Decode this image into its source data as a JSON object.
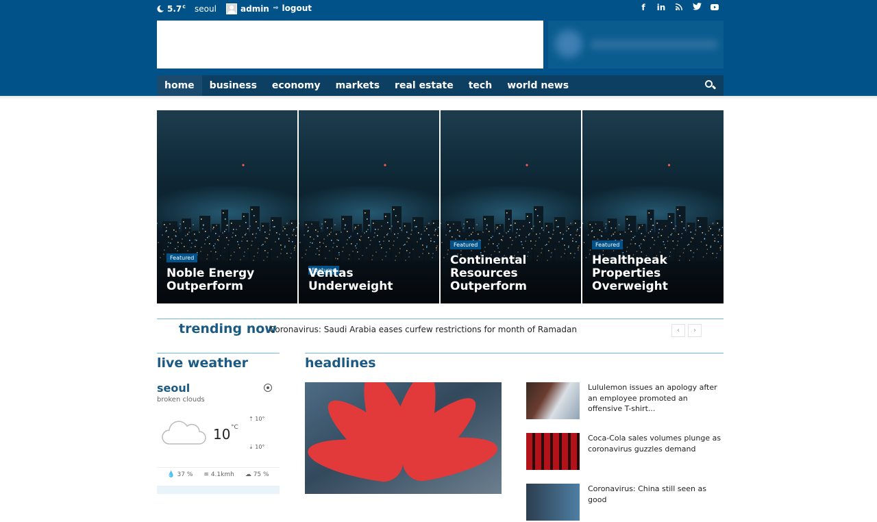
{
  "topbar": {
    "temperature": "5.7",
    "temp_unit": "c",
    "city": "seoul",
    "user": "admin",
    "logout": "logout",
    "social_glyphs": [
      "f",
      "in",
      "rss",
      "tw",
      "yt"
    ]
  },
  "nav": {
    "items": [
      "home",
      "business",
      "economy",
      "markets",
      "real estate",
      "tech",
      "world news"
    ]
  },
  "featured": [
    {
      "badge": "Featured",
      "title": "Noble Energy Outperform"
    },
    {
      "badge": "Featured",
      "title": "Ventas Underweight"
    },
    {
      "badge": "Featured",
      "title": "Continental Resources Outperform"
    },
    {
      "badge": "Featured",
      "title": "Healthpeak Properties Overweight"
    }
  ],
  "trending": {
    "label": "trending now",
    "text": "Coronavirus: Saudi Arabia eases curfew restrictions for month of Ramadan",
    "prev": "‹",
    "next": "›"
  },
  "weather": {
    "title": "live weather",
    "city": "seoul",
    "description": "broken clouds",
    "temp": "10",
    "unit": "°C",
    "high": "10°",
    "low": "10°",
    "humidity": "37 %",
    "wind": "4.1kmh",
    "clouds": "75 %"
  },
  "headlines": {
    "title": "headlines",
    "items": [
      "Lululemon issues an apology after an employee promoted an offensive T-shirt...",
      "Coca-Cola sales volumes plunge as coronavirus guzzles demand",
      "Coronavirus: China still seen as good"
    ]
  },
  "colors": {
    "brand": "#005288",
    "nav_dark": "#0d3f62",
    "accent_line": "#6fb8e0",
    "heading": "#1b5a82"
  }
}
